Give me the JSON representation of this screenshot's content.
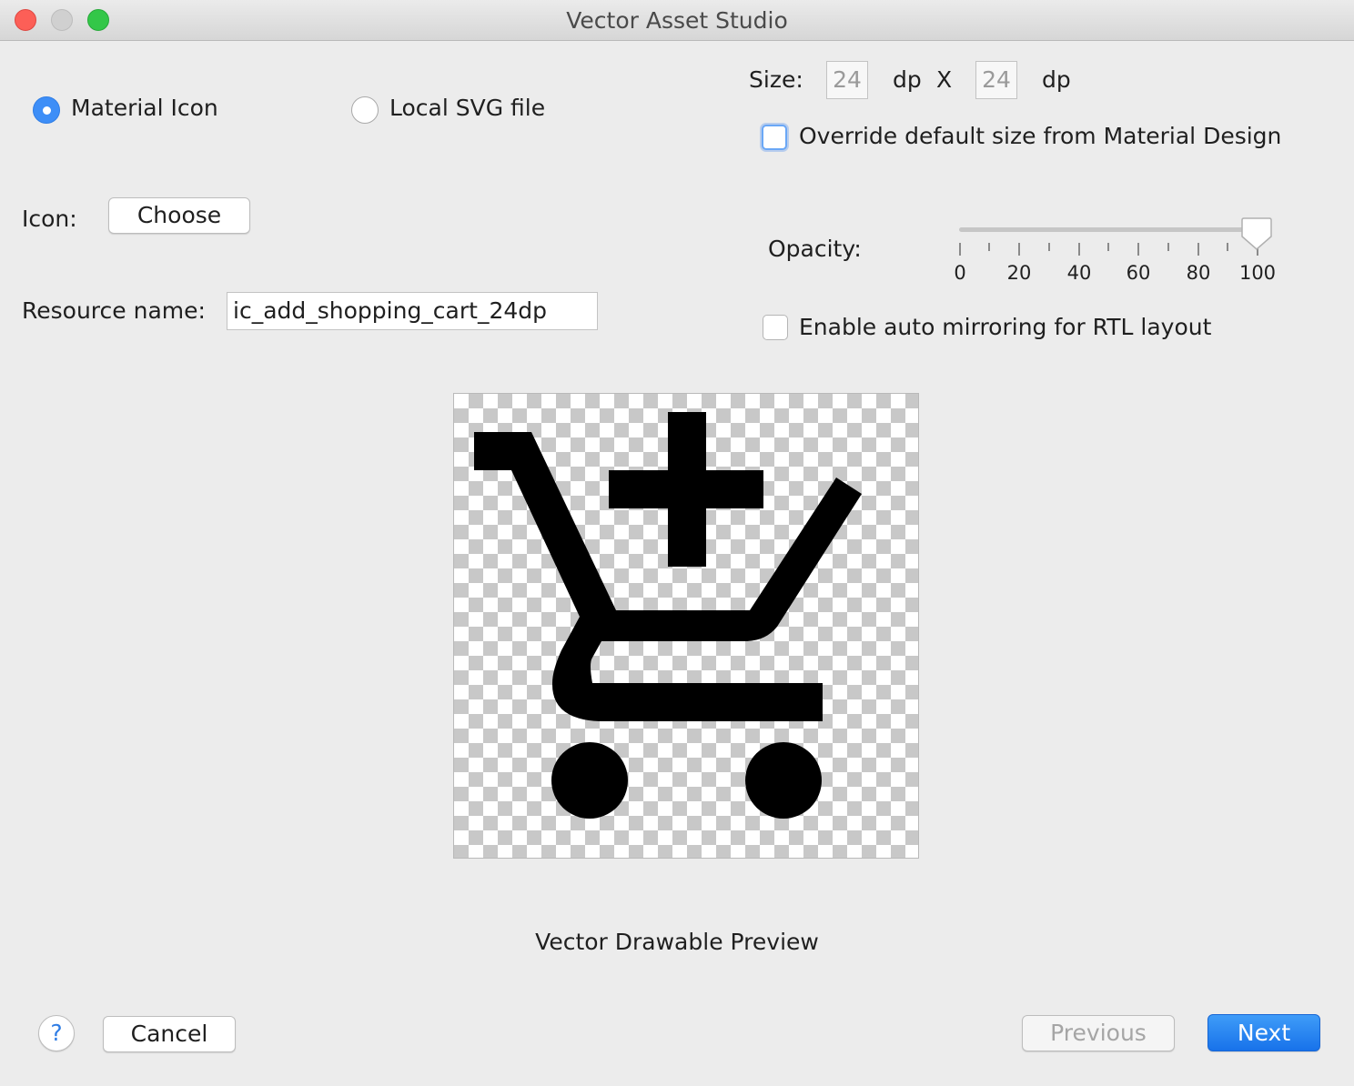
{
  "window": {
    "title": "Vector Asset Studio"
  },
  "source": {
    "options": [
      {
        "label": "Material Icon",
        "selected": true
      },
      {
        "label": "Local SVG file",
        "selected": false
      }
    ]
  },
  "icon": {
    "label": "Icon:",
    "choose_button": "Choose",
    "icon_name": "add-shopping-cart-icon"
  },
  "resource": {
    "label": "Resource name:",
    "value": "ic_add_shopping_cart_24dp"
  },
  "size": {
    "label": "Size:",
    "width": "24",
    "height": "24",
    "unit": "dp",
    "separator": "X"
  },
  "override": {
    "label": "Override default size from Material Design",
    "checked": false
  },
  "opacity": {
    "label": "Opacity:",
    "value": 100,
    "tick_labels": [
      "0",
      "20",
      "40",
      "60",
      "80",
      "100"
    ]
  },
  "mirroring": {
    "label": "Enable auto mirroring for RTL layout",
    "checked": false
  },
  "preview": {
    "caption": "Vector Drawable Preview"
  },
  "footer": {
    "help": "?",
    "cancel": "Cancel",
    "previous": "Previous",
    "next": "Next"
  },
  "colors": {
    "accent": "#3d8ef7",
    "primary_button": "#1872ea",
    "window_bg": "#ececec"
  }
}
